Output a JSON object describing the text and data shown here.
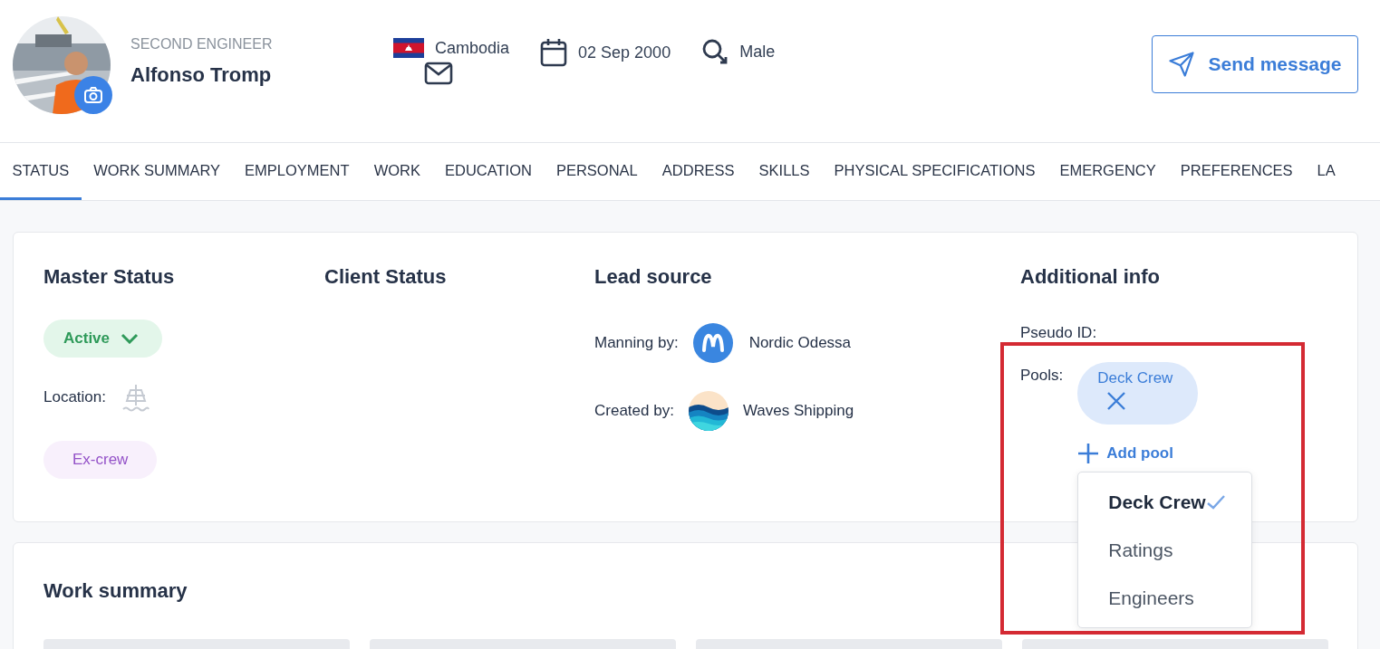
{
  "profile": {
    "role": "SECOND ENGINEER",
    "name": "Alfonso Tromp",
    "country": "Cambodia",
    "birth_date": "02 Sep 2000",
    "gender": "Male"
  },
  "send_button": "Send message",
  "tabs": [
    {
      "label": "STATUS",
      "selected": true
    },
    {
      "label": "WORK SUMMARY",
      "selected": false
    },
    {
      "label": "EMPLOYMENT",
      "selected": false
    },
    {
      "label": "WORK",
      "selected": false
    },
    {
      "label": "EDUCATION",
      "selected": false
    },
    {
      "label": "PERSONAL",
      "selected": false
    },
    {
      "label": "ADDRESS",
      "selected": false
    },
    {
      "label": "SKILLS",
      "selected": false
    },
    {
      "label": "PHYSICAL SPECIFICATIONS",
      "selected": false
    },
    {
      "label": "EMERGENCY",
      "selected": false
    },
    {
      "label": "PREFERENCES",
      "selected": false
    },
    {
      "label": "LA",
      "selected": false
    }
  ],
  "master_status": {
    "title": "Master Status",
    "status": "Active",
    "location_label": "Location:",
    "tag": "Ex-crew"
  },
  "client_status": {
    "title": "Client Status"
  },
  "lead_source": {
    "title": "Lead source",
    "rows": [
      {
        "label": "Manning by:",
        "value": "Nordic Odessa"
      },
      {
        "label": "Created by:",
        "value": "Waves Shipping"
      }
    ]
  },
  "additional_info": {
    "title": "Additional info",
    "pseudo_id_label": "Pseudo ID:",
    "pools_label": "Pools:",
    "pools": [
      "Deck Crew"
    ],
    "add_pool": "Add pool",
    "pool_menu": [
      {
        "label": "Deck Crew",
        "selected": true
      },
      {
        "label": "Ratings",
        "selected": false
      },
      {
        "label": "Engineers",
        "selected": false
      }
    ]
  },
  "work_summary": {
    "title": "Work summary"
  }
}
